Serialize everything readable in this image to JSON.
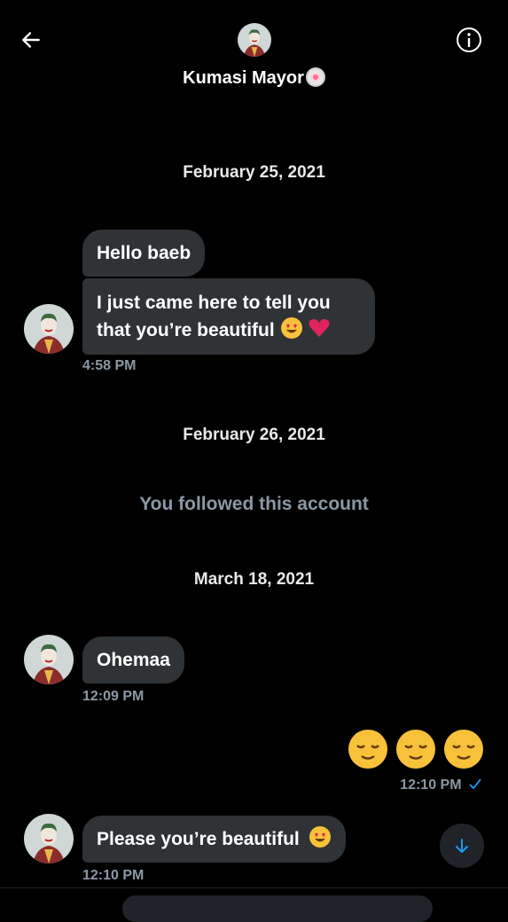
{
  "header": {
    "title": "Kumasi Mayor",
    "back_icon": "arrow-left-icon",
    "info_icon": "info-icon"
  },
  "dates": {
    "d1": "February 25, 2021",
    "d2": "February 26, 2021",
    "d3": "March 18, 2021"
  },
  "system_message": "You followed this account",
  "messages": {
    "m1": "Hello baeb",
    "m2_line1": "I just came here to tell you",
    "m2_line2": "that you’re beautiful",
    "m2_time": "4:58 PM",
    "m3": "Ohemaa",
    "m3_time": "12:09 PM",
    "sent_time": "12:10 PM",
    "m5": "Please you’re beautiful",
    "m5_time": "12:10 PM"
  },
  "colors": {
    "accent": "#1d9bf0",
    "bubble": "#2f3336",
    "muted": "#8b98a5"
  }
}
